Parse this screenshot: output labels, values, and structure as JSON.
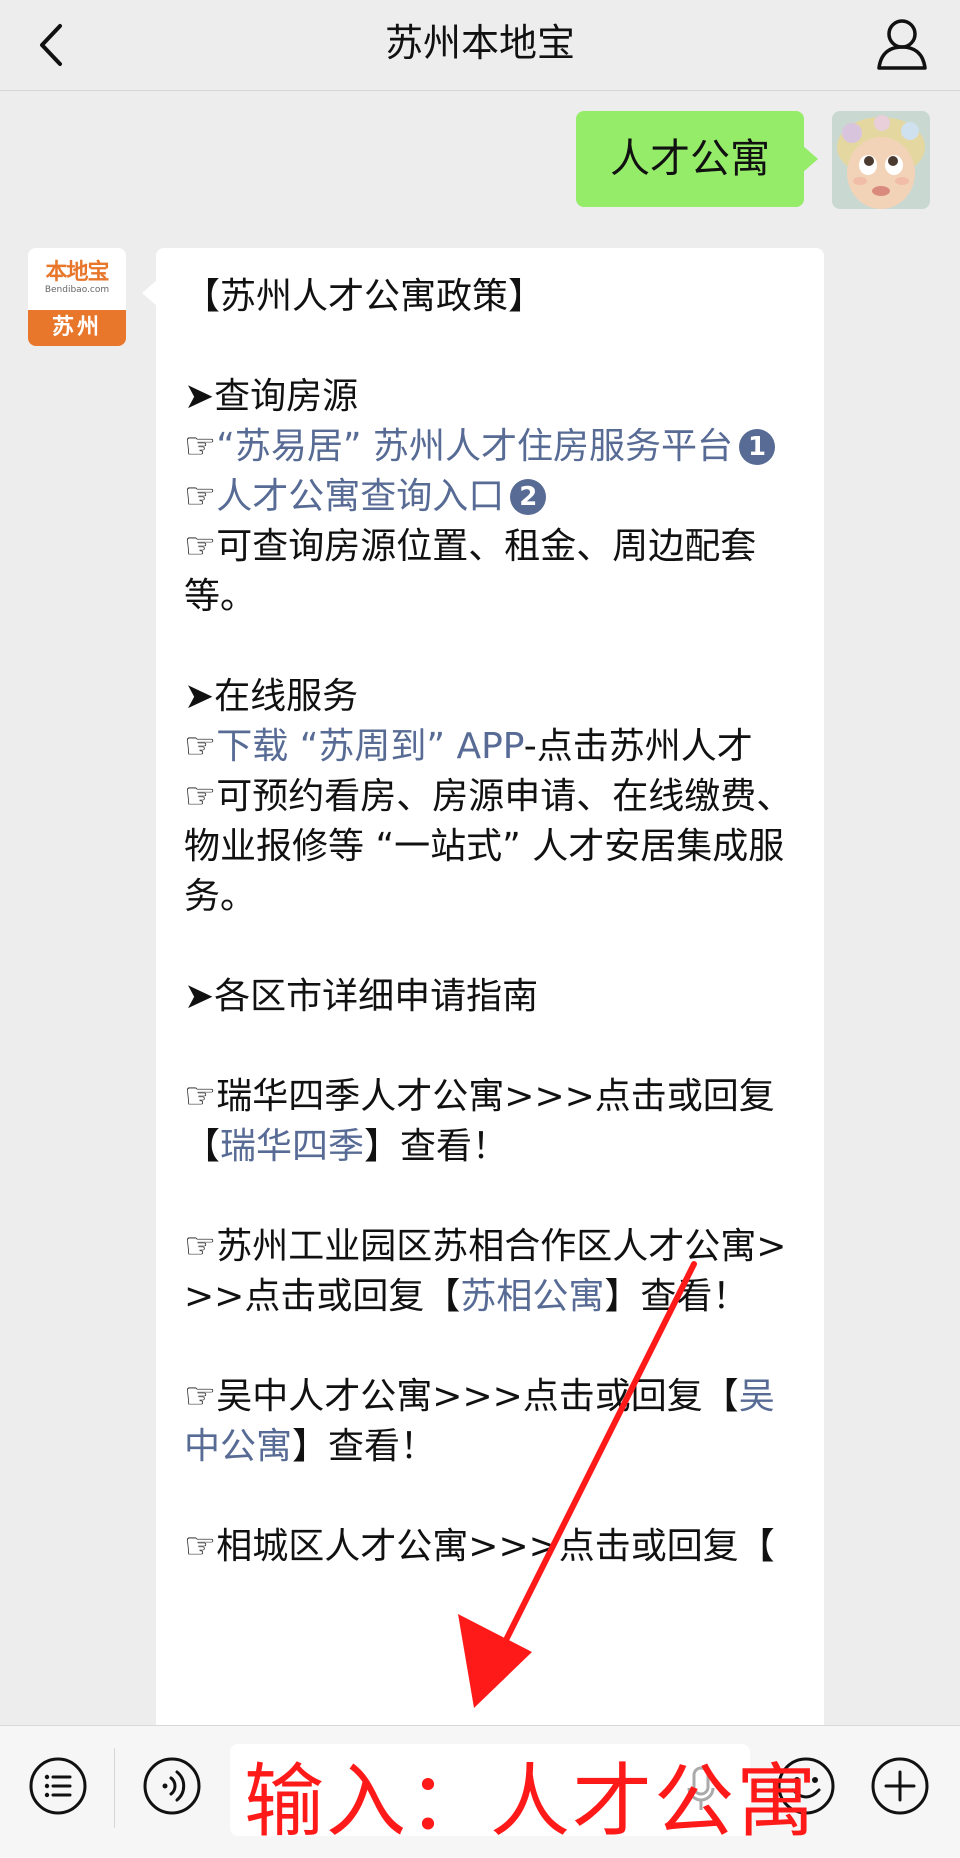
{
  "header": {
    "title": "苏州本地宝"
  },
  "sent_message": {
    "text": "人才公寓"
  },
  "bot_avatar": {
    "logo_text": "本地宝",
    "logo_sub": "Bendibao.com",
    "city": "苏州"
  },
  "received_message": {
    "l1": "【苏州人才公寓政策】",
    "l2": "➤查询房源",
    "l3_prefix": "☞",
    "l3_link": "“苏易居” 苏州人才住房服务平台",
    "badge1": "1",
    "l4_prefix": "☞",
    "l4_link": "人才公寓查询入口",
    "badge2": "2",
    "l5": "☞可查询房源位置、租金、周边配套等。",
    "l6": "➤在线服务",
    "l7_prefix": "☞",
    "l7_link": "下载 “苏周到” APP",
    "l7_suffix": "-点击苏州人才",
    "l8": "☞可预约看房、房源申请、在线缴费、物业报修等 “一站式” 人才安居集成服务。",
    "l9": "➤各区市详细申请指南",
    "l10_prefix": "☞瑞华四季人才公寓>>>点击或回复【",
    "l10_link": "瑞华四季",
    "l10_suffix": "】查看！",
    "l11_prefix": "☞苏州工业园区苏相合作区人才公寓>>>点击或回复【",
    "l11_link": "苏相公寓",
    "l11_suffix": "】查看！",
    "l12_prefix": "☞吴中人才公寓>>>点击或回复【",
    "l12_link": "吴中公寓",
    "l12_suffix": "】查看！",
    "l13": "☞相城区人才公寓>>>点击或回复【"
  },
  "annotation": {
    "text": "输入：人才公寓"
  },
  "colors": {
    "link": "#576b95",
    "sent_bubble": "#95ec69",
    "annotation": "#ff1a1a",
    "brand_orange": "#e8762b"
  },
  "icons": [
    "back-arrow-icon",
    "profile-icon",
    "menu-list-icon",
    "voice-icon",
    "microphone-icon",
    "emoji-icon",
    "plus-icon"
  ]
}
